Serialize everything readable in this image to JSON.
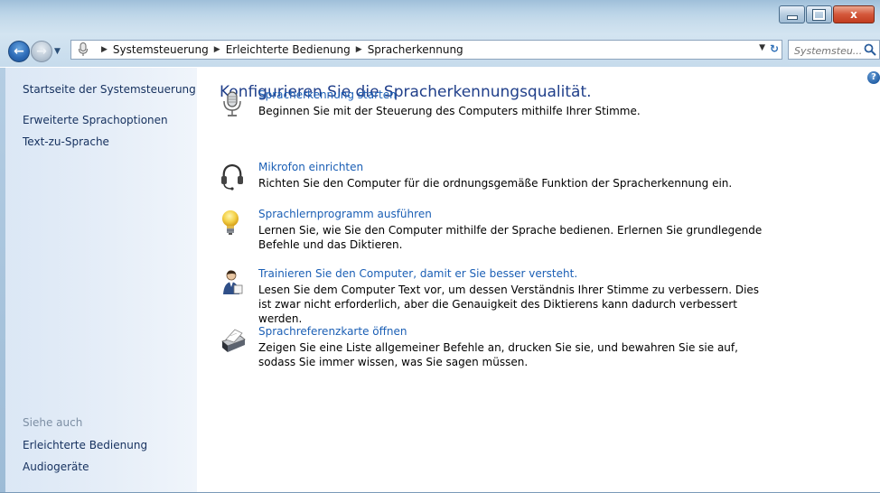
{
  "window": {
    "controls": {
      "minimize": "minimize",
      "maximize": "maximize",
      "close": "x"
    }
  },
  "address": {
    "crumbs": [
      "Systemsteuerung",
      "Erleichterte Bedienung",
      "Spracherkennung"
    ]
  },
  "search": {
    "placeholder": "Systemsteu..."
  },
  "sidebar": {
    "home_link": "Startseite der Systemsteuerung",
    "links": [
      "Erweiterte Sprachoptionen",
      "Text-zu-Sprache"
    ],
    "see_also_heading": "Siehe auch",
    "see_also": [
      "Erleichterte Bedienung",
      "Audiogeräte"
    ]
  },
  "main": {
    "title": "Konfigurieren Sie die Spracherkennungsqualität.",
    "help": "?",
    "tasks": [
      {
        "icon": "microphone-icon",
        "link": "Spracherkennung starten",
        "desc": "Beginnen Sie mit der Steuerung des Computers mithilfe Ihrer Stimme."
      },
      {
        "icon": "headset-icon",
        "link": "Mikrofon einrichten",
        "desc": "Richten Sie den Computer für die ordnungsgemäße Funktion der Spracherkennung ein."
      },
      {
        "icon": "lightbulb-icon",
        "link": "Sprachlernprogramm ausführen",
        "desc": "Lernen Sie, wie Sie den Computer mithilfe der Sprache bedienen. Erlernen Sie grundlegende Befehle und das Diktieren."
      },
      {
        "icon": "user-training-icon",
        "link": "Trainieren Sie den Computer, damit er Sie besser versteht.",
        "desc": "Lesen Sie dem Computer Text vor, um dessen Verständnis Ihrer Stimme zu verbessern. Dies ist zwar nicht erforderlich, aber die Genauigkeit des Diktierens kann dadurch verbessert werden."
      },
      {
        "icon": "printer-icon",
        "link": "Sprachreferenzkarte öffnen",
        "desc": "Zeigen Sie eine Liste allgemeiner Befehle an, drucken Sie sie, und bewahren Sie sie auf, sodass Sie immer wissen, was Sie sagen müssen."
      }
    ]
  },
  "colors": {
    "link": "#1b5fb5",
    "title": "#203f8a",
    "sidebar_link": "#15305e",
    "muted": "#7d8fa4"
  }
}
